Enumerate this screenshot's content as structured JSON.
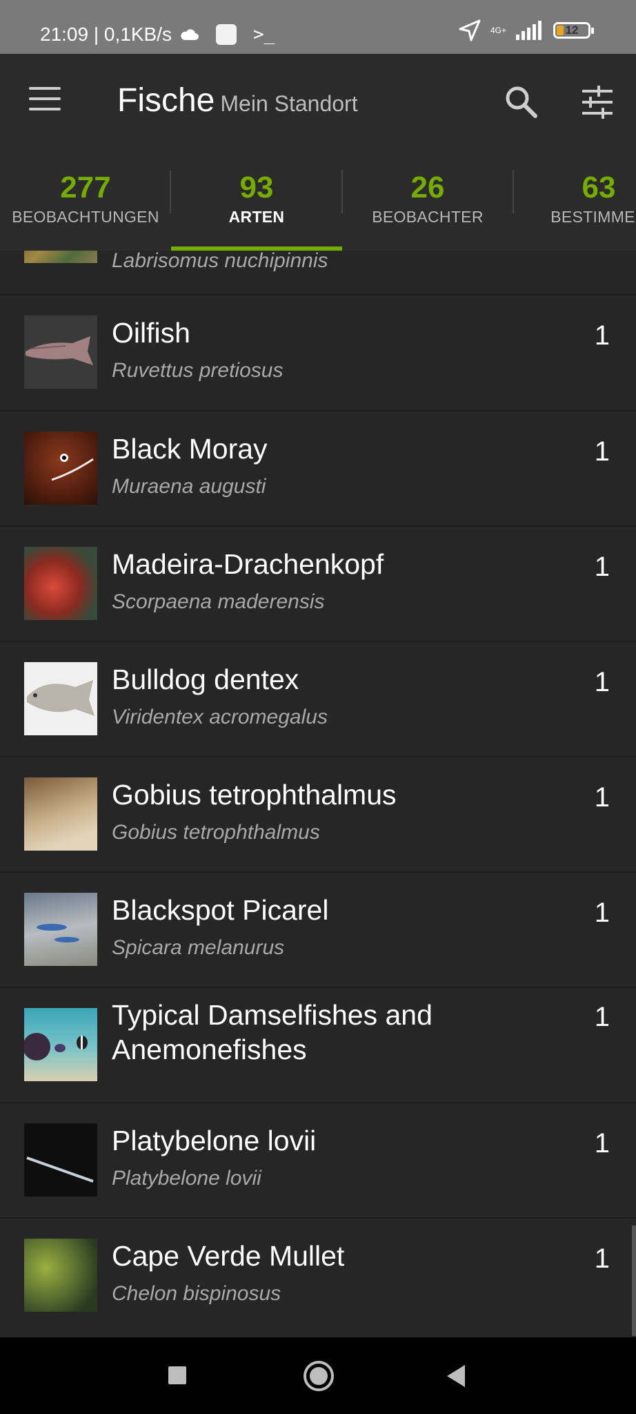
{
  "status_bar": {
    "time_speed": "21:09 | 0,1KB/s",
    "network": "4G+",
    "battery": "12",
    "colors": {
      "battery_fill": "#e8a51a"
    }
  },
  "appbar": {
    "title": "Fische",
    "subtitle": "Mein Standort",
    "icons": {
      "menu": "menu-icon",
      "search": "search-icon",
      "filter": "filter-sliders-icon"
    }
  },
  "tabs": [
    {
      "count": "277",
      "label": "BEOBACHTUNGEN",
      "active": false
    },
    {
      "count": "93",
      "label": "ARTEN",
      "active": true
    },
    {
      "count": "26",
      "label": "BEOBACHTER",
      "active": false
    },
    {
      "count": "63",
      "label": "BESTIMMER",
      "active": false
    }
  ],
  "accent_color": "#74ac00",
  "species": [
    {
      "common": "",
      "scientific": "Labrisomus nuchipinnis",
      "count": ""
    },
    {
      "common": "Oilfish",
      "scientific": "Ruvettus pretiosus",
      "count": "1"
    },
    {
      "common": "Black Moray",
      "scientific": "Muraena augusti",
      "count": "1"
    },
    {
      "common": "Madeira-Drachenkopf",
      "scientific": "Scorpaena maderensis",
      "count": "1"
    },
    {
      "common": "Bulldog dentex",
      "scientific": "Viridentex acromegalus",
      "count": "1"
    },
    {
      "common": "Gobius tetrophthalmus",
      "scientific": "Gobius tetrophthalmus",
      "count": "1"
    },
    {
      "common": "Blackspot Picarel",
      "scientific": "Spicara melanurus",
      "count": "1"
    },
    {
      "common": "Typical Damselfishes and",
      "common_line2": "Anemonefishes",
      "scientific": "",
      "count": "1"
    },
    {
      "common": "Platybelone lovii",
      "scientific": "Platybelone lovii",
      "count": "1"
    },
    {
      "common": "Cape Verde Mullet",
      "scientific": "Chelon bispinosus",
      "count": "1"
    }
  ],
  "navbar": {
    "icons": [
      "recents-square-icon",
      "home-circle-icon",
      "back-triangle-icon"
    ]
  }
}
